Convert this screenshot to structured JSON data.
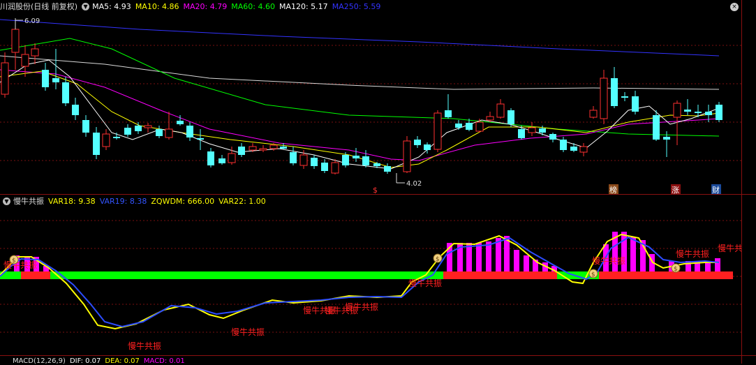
{
  "main_panel": {
    "title": "川润股份(日线 前复权)",
    "indicators": [
      {
        "label": "MA5: 4.93",
        "color": "#ffffff"
      },
      {
        "label": "MA10: 4.86",
        "color": "#ffff00"
      },
      {
        "label": "MA20: 4.79",
        "color": "#ff00ff"
      },
      {
        "label": "MA60: 4.60",
        "color": "#00ff00"
      },
      {
        "label": "MA120: 5.17",
        "color": "#ffffff"
      },
      {
        "label": "MA250: 5.59",
        "color": "#3333ff"
      }
    ],
    "high_label": "6.09",
    "low_label": "4.02",
    "markers": [
      {
        "text": "$",
        "color": "#ff3333"
      },
      {
        "text": "榜",
        "color": "#ffffff",
        "bg": "#8a4a1a"
      },
      {
        "text": "涨",
        "color": "#ffffff",
        "bg": "#8a1010"
      },
      {
        "text": "财",
        "color": "#ffffff",
        "bg": "#1a4a9a"
      }
    ]
  },
  "sub_panel": {
    "title": "慢牛共振",
    "indicators": [
      {
        "label": "VAR18: 9.38",
        "color": "#ffff00"
      },
      {
        "label": "VAR19: 8.38",
        "color": "#3355ff"
      },
      {
        "label": "ZQWDM: 666.00",
        "color": "#ffff00"
      },
      {
        "label": "VAR22: 1.00",
        "color": "#ffff00"
      }
    ],
    "signal_label": "慢牛共振",
    "signal_color": "#ff2020"
  },
  "macd_panel": {
    "title": "MACD(12,26,9)",
    "indicators": [
      {
        "label": "DIF: 0.07",
        "color": "#ffffff"
      },
      {
        "label": "DEA: 0.07",
        "color": "#ffff00"
      },
      {
        "label": "MACD: 0.01",
        "color": "#ff00ff"
      }
    ]
  },
  "colors": {
    "up": "#ff3030",
    "down": "#54ffff",
    "grid": "#7a0f0f"
  },
  "icons": {
    "collapse": "chevron-down-icon",
    "close": "close-icon"
  }
}
